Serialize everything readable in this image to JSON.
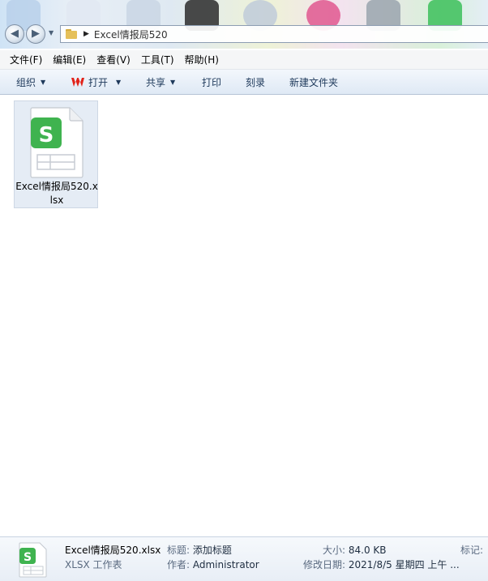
{
  "window": {
    "breadcrumb": "Excel情报局520"
  },
  "menu": {
    "items": [
      "文件(F)",
      "编辑(E)",
      "查看(V)",
      "工具(T)",
      "帮助(H)"
    ]
  },
  "toolbar": {
    "organize": "组织",
    "open": "打开",
    "share": "共享",
    "print": "打印",
    "burn": "刻录",
    "new_folder": "新建文件夹"
  },
  "files": [
    {
      "name": "Excel情报局520.xlsx",
      "icon": "wps-spreadsheet-icon",
      "selected": true
    }
  ],
  "details": {
    "file_name": "Excel情报局520.xlsx",
    "file_type": "XLSX 工作表",
    "title_label": "标题:",
    "title_value": "添加标题",
    "author_label": "作者:",
    "author_value": "Administrator",
    "size_label": "大小:",
    "size_value": "84.0 KB",
    "modified_label": "修改日期:",
    "modified_value": "2021/8/5 星期四 上午 ...",
    "tags_label": "标记:"
  },
  "colors": {
    "accent_green": "#3fb34f",
    "selection": "#e5ecf5",
    "toolbar_text": "#1e395b"
  }
}
